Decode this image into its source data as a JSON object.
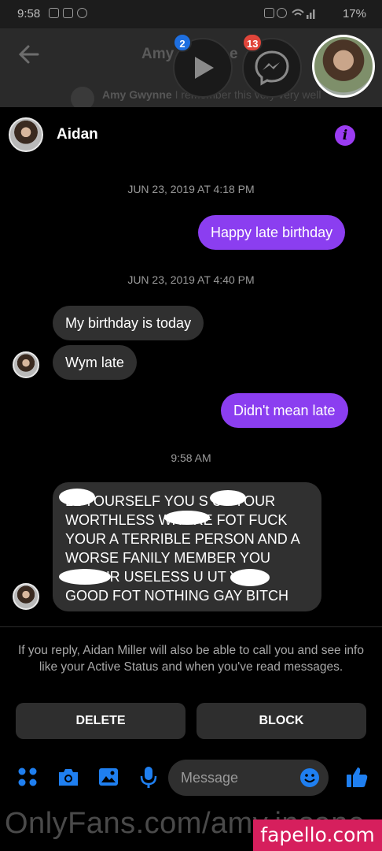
{
  "status_bar": {
    "time": "9:58",
    "battery": "17%"
  },
  "background_header": {
    "title": "Amy",
    "title_end": "e",
    "preview_name": "Amy Gwynne",
    "preview_text": "I remember this very very well"
  },
  "chat_heads": {
    "video_badge": "2",
    "messenger_badge": "13"
  },
  "conversation": {
    "name": "Aidan",
    "info_icon": "i"
  },
  "messages": {
    "stamp1": "JUN 23, 2019 AT 4:18 PM",
    "out1": "Happy late birthday",
    "stamp2": "JUN 23, 2019 AT 4:40 PM",
    "in1": "My birthday is today",
    "in2": "Wym late",
    "out2": "Didn't mean late",
    "stamp3": "9:58 AM",
    "big_lines": [
      "LL YOURSELF YOU S UT YOUR",
      "WORTHLESS WHORE FOT FUCK",
      "YOUR A TERRIBLE PERSON AND A",
      "WORSE FANILY MEMBER YOU",
      "C YOUR USELESS U  UT YOU",
      "GOOD FOT NOTHING GAY BITCH"
    ]
  },
  "request_notice": "If you reply, Aidan Miller will also be able to call you and see info like your Active Status and when you've read messages.",
  "actions": {
    "delete": "DELETE",
    "block": "BLOCK"
  },
  "composer": {
    "placeholder": "Message"
  },
  "watermarks": {
    "left": "OnlyFans.com/amy.insane",
    "right": "fapello.com"
  },
  "colors": {
    "outgoing_bubble": "#8b3ef0",
    "incoming_bubble": "#303030",
    "accent_blue": "#1f7ff0",
    "video_badge": "#1e6fe0",
    "messenger_badge": "#e0453a"
  }
}
